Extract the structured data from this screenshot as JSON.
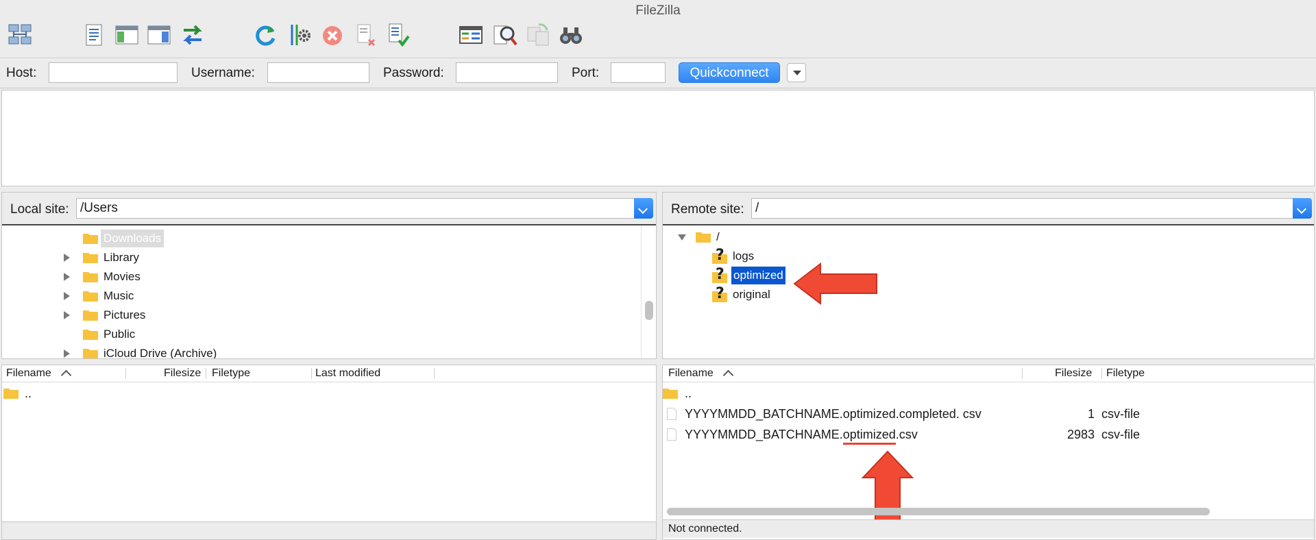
{
  "window": {
    "title": "FileZilla"
  },
  "toolbar": {
    "icons": [
      "site-manager-icon",
      "message-log-icon",
      "local-tree-icon",
      "remote-tree-icon",
      "transfer-queue-icon",
      "refresh-icon",
      "process-queue-icon",
      "cancel-icon",
      "disconnect-icon",
      "reconnect-icon",
      "directory-listing-filter-icon",
      "compare-icon",
      "sync-browse-icon",
      "search-icon"
    ]
  },
  "quickconnect": {
    "host_label": "Host:",
    "username_label": "Username:",
    "password_label": "Password:",
    "port_label": "Port:",
    "host_value": "",
    "username_value": "",
    "password_value": "",
    "port_value": "",
    "button_label": "Quickconnect"
  },
  "local": {
    "site_label": "Local site:",
    "path": "/Users",
    "tree": [
      {
        "label": "Downloads",
        "expandable": false,
        "selected": true
      },
      {
        "label": "Library",
        "expandable": true
      },
      {
        "label": "Movies",
        "expandable": true
      },
      {
        "label": "Music",
        "expandable": true
      },
      {
        "label": "Pictures",
        "expandable": true
      },
      {
        "label": "Public",
        "expandable": false
      },
      {
        "label": "iCloud Drive (Archive)",
        "expandable": true
      }
    ],
    "columns": [
      "Filename",
      "Filesize",
      "Filetype",
      "Last modified"
    ],
    "files": [
      {
        "name": ".."
      }
    ]
  },
  "remote": {
    "site_label": "Remote site:",
    "path": "/",
    "tree_root": "/",
    "tree": [
      {
        "label": "logs"
      },
      {
        "label": "optimized",
        "selected": true
      },
      {
        "label": "original"
      }
    ],
    "columns": [
      "Filename",
      "Filesize",
      "Filetype"
    ],
    "files": [
      {
        "name": "..",
        "size": "",
        "type": ""
      },
      {
        "name": "YYYYMMDD_BATCHNAME.optimized.completed. csv",
        "size": "1",
        "type": "csv-file"
      },
      {
        "name_prefix": "YYYYMMDD_BATCHNAME.",
        "name_highlight": "optimized",
        "name_suffix": ".csv",
        "size": "2983",
        "type": "csv-file"
      }
    ],
    "status": "Not connected."
  },
  "colors": {
    "accent": "#2f86f3",
    "selection": "#0a57d0",
    "arrow": "#f04a35",
    "folder": "#f7c23c"
  }
}
